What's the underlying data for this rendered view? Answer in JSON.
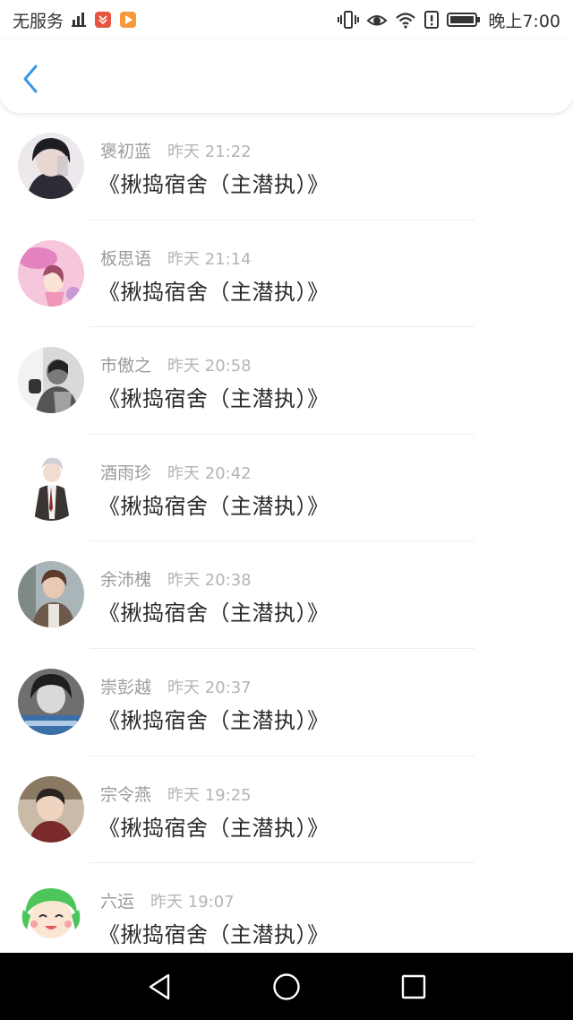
{
  "status_bar": {
    "carrier": "无服务",
    "time": "晚上7:00",
    "left_icons": [
      "signal-icon",
      "app-notification-icon",
      "video-app-icon"
    ],
    "right_icons": [
      "vibrate-icon",
      "eye-comfort-icon",
      "wifi-icon",
      "alert-icon",
      "battery-icon"
    ]
  },
  "header": {
    "back_icon": "chevron-left-icon",
    "accent": "#3a97e8"
  },
  "items": [
    {
      "name": "褒初蓝",
      "time": "昨天 21:22",
      "title": "《揪捣宿舍（主潜执）》"
    },
    {
      "name": "板思语",
      "time": "昨天 21:14",
      "title": "《揪捣宿舍（主潜执）》"
    },
    {
      "name": "市傲之",
      "time": "昨天 20:58",
      "title": "《揪捣宿舍（主潜执）》"
    },
    {
      "name": "酒雨珍",
      "time": "昨天 20:42",
      "title": "《揪捣宿舍（主潜执）》"
    },
    {
      "name": "余沛槐",
      "time": "昨天 20:38",
      "title": "《揪捣宿舍（主潜执）》"
    },
    {
      "name": "崇彭越",
      "time": "昨天 20:37",
      "title": "《揪捣宿舍（主潜执）》"
    },
    {
      "name": "宗令燕",
      "time": "昨天 19:25",
      "title": "《揪捣宿舍（主潜执）》"
    },
    {
      "name": "六运",
      "time": "昨天 19:07",
      "title": "《揪捣宿舍（主潜执）》"
    }
  ],
  "nav_bar": {
    "buttons": [
      "back-triangle-icon",
      "home-circle-icon",
      "recents-square-icon"
    ]
  }
}
